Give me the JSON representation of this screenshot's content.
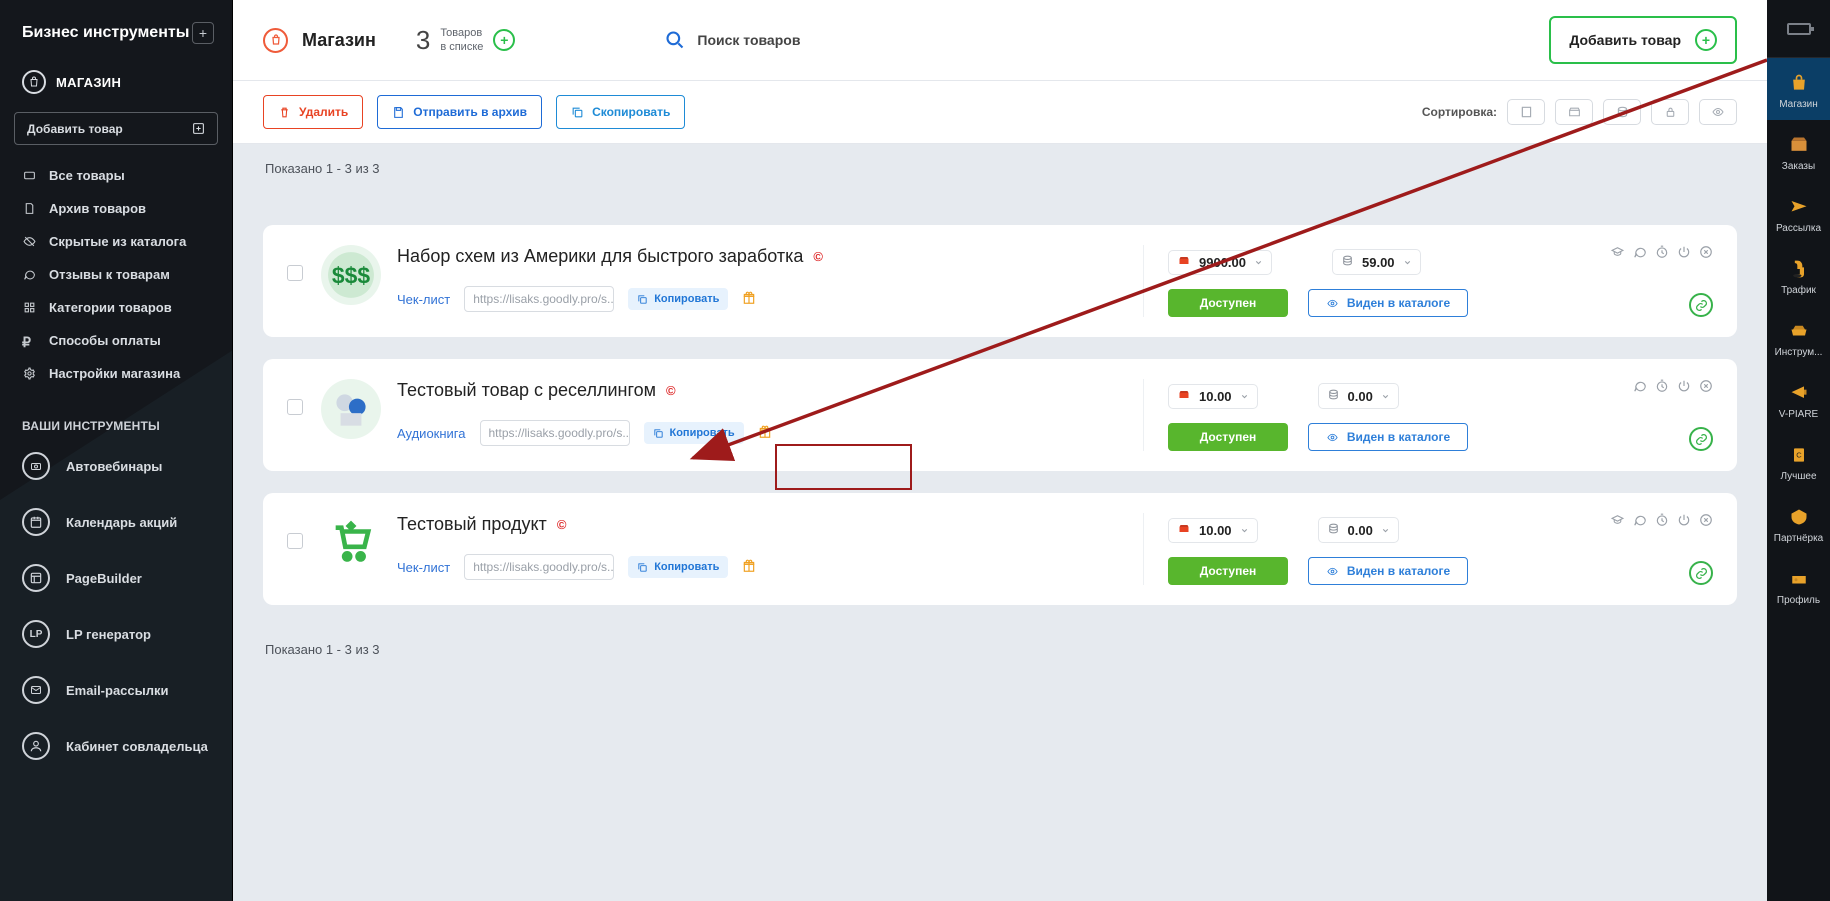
{
  "left": {
    "title": "Бизнес инструменты",
    "store_label": "МАГАЗИН",
    "add_product": "Добавить товар",
    "menu": [
      "Все товары",
      "Архив товаров",
      "Скрытые из каталога",
      "Отзывы к товарам",
      "Категории товаров",
      "Способы оплаты",
      "Настройки магазина"
    ],
    "section": "ВАШИ ИНСТРУМЕНТЫ",
    "tools": [
      "Автовебинары",
      "Календарь акций",
      "PageBuilder",
      "LP генератор",
      "Email-рассылки",
      "Кабинет совладельца"
    ]
  },
  "header": {
    "page": "Магазин",
    "count": "3",
    "goods_a": "Товаров",
    "goods_b": "в списке",
    "search": "Поиск товаров",
    "add": "Добавить товар"
  },
  "toolbar": {
    "delete": "Удалить",
    "archive": "Отправить в архив",
    "copy": "Скопировать",
    "sort": "Сортировка:"
  },
  "shown": "Показано 1 - 3 из 3",
  "labels": {
    "copy": "Копировать",
    "available": "Доступен",
    "visible": "Виден в каталоге"
  },
  "products": [
    {
      "title": "Набор схем из Америки для быстрого заработка",
      "type": "Чек-лист",
      "url": "https://lisaks.goodly.pro/s...",
      "price": "9900.00",
      "price2": "59.00",
      "cap": true
    },
    {
      "title": "Тестовый товар с реселлингом",
      "type": "Аудиокнига",
      "url": "https://lisaks.goodly.pro/s...",
      "price": "10.00",
      "price2": "0.00",
      "cap": false
    },
    {
      "title": "Тестовый продукт",
      "type": "Чек-лист",
      "url": "https://lisaks.goodly.pro/s...",
      "price": "10.00",
      "price2": "0.00",
      "cap": true
    }
  ],
  "rail": [
    "Магазин",
    "Заказы",
    "Рассылка",
    "Трафик",
    "Инструм...",
    "V-PIARE",
    "Лучшее",
    "Партнёрка",
    "Профиль"
  ]
}
